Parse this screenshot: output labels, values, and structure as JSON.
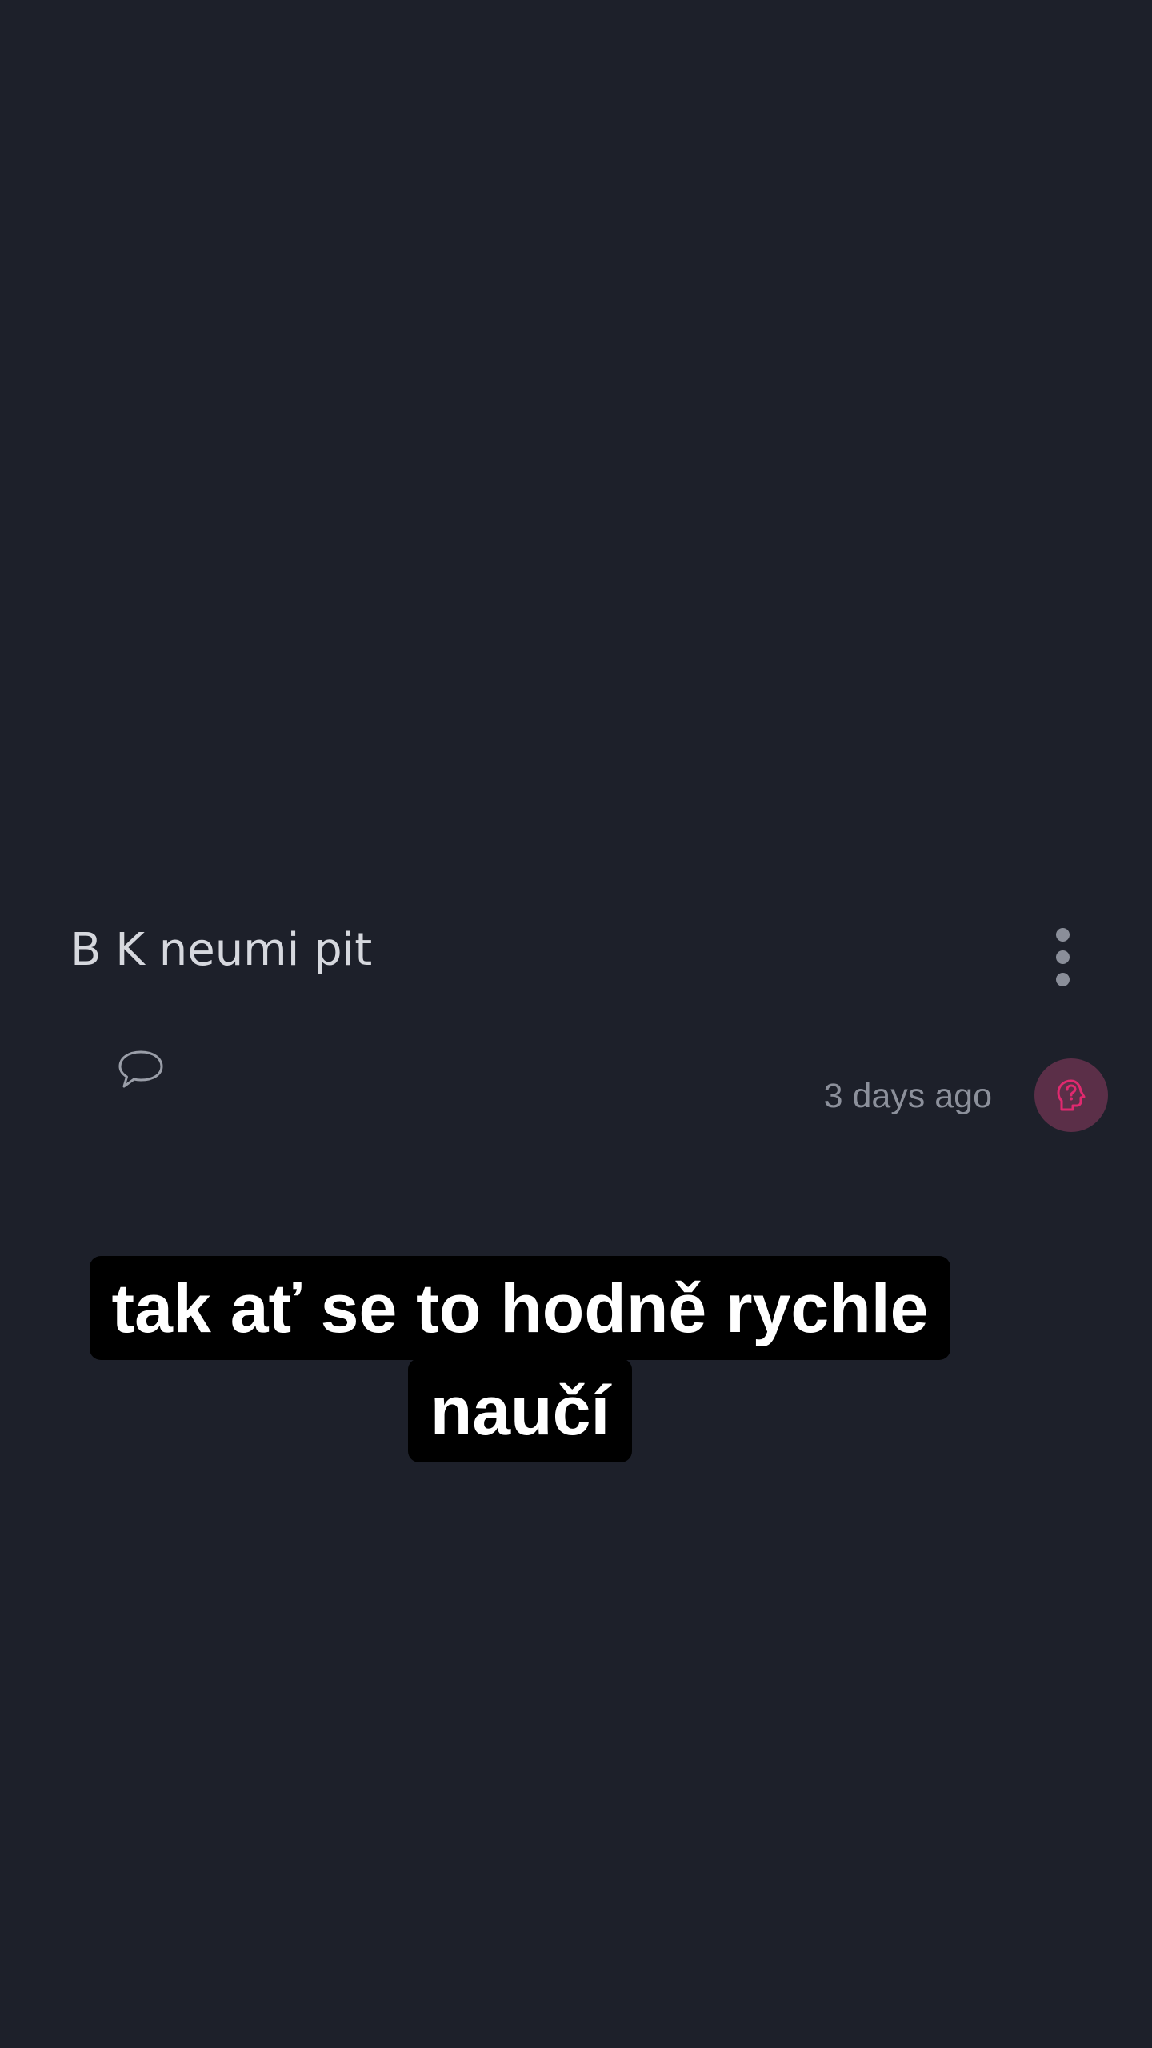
{
  "post": {
    "title": "B K neumi pit",
    "timestamp": "3 days ago"
  },
  "icons": {
    "more": "more-vertical-icon",
    "comment": "comment-bubble-icon",
    "avatar": "head-question-icon"
  },
  "caption": {
    "line1": "tak ať se to hodně rychle",
    "line2": "naučí"
  },
  "colors": {
    "background": "#1d202a",
    "avatar_bg": "#5b2f48",
    "avatar_icon": "#e0296f",
    "caption_bg": "#000000",
    "caption_text": "#ffffff"
  }
}
